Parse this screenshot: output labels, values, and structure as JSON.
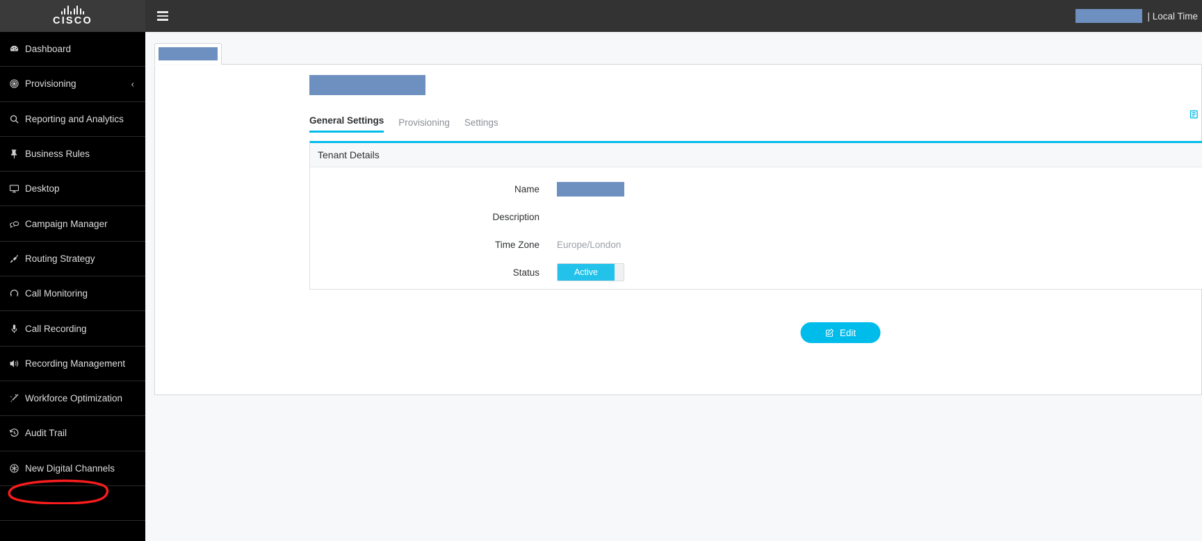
{
  "topbar": {
    "logo_text": "CISCO",
    "menu_icon": "hamburger-icon",
    "user_redacted": "",
    "local_time_label": "| Local Time"
  },
  "sidebar": {
    "items": [
      {
        "label": "Dashboard",
        "icon": "dashboard-icon",
        "expandable": false
      },
      {
        "label": "Provisioning",
        "icon": "target-icon",
        "expandable": true,
        "chevron": "‹"
      },
      {
        "label": "Reporting and Analytics",
        "icon": "search-icon",
        "expandable": false
      },
      {
        "label": "Business Rules",
        "icon": "pin-icon",
        "expandable": false
      },
      {
        "label": "Desktop",
        "icon": "monitor-icon",
        "expandable": false
      },
      {
        "label": "Campaign Manager",
        "icon": "chat-bubbles-icon",
        "expandable": false
      },
      {
        "label": "Routing Strategy",
        "icon": "plug-icon",
        "expandable": false
      },
      {
        "label": "Call Monitoring",
        "icon": "headset-icon",
        "expandable": false
      },
      {
        "label": "Call Recording",
        "icon": "microphone-icon",
        "expandable": false
      },
      {
        "label": "Recording Management",
        "icon": "speaker-icon",
        "expandable": false
      },
      {
        "label": "Workforce Optimization",
        "icon": "magic-wand-icon",
        "expandable": false
      },
      {
        "label": "Audit Trail",
        "icon": "history-icon",
        "expandable": false
      },
      {
        "label": "New Digital Channels",
        "icon": "asterisk-circle-icon",
        "expandable": false,
        "annotated": true
      }
    ],
    "annotation_color": "#f91c1c"
  },
  "main": {
    "tab_redacted": "",
    "page_title_redacted": "",
    "share_icon": "external-link-icon",
    "subtabs": [
      {
        "label": "General Settings",
        "active": true
      },
      {
        "label": "Provisioning",
        "active": false
      },
      {
        "label": "Settings",
        "active": false
      }
    ],
    "panel": {
      "heading": "Tenant Details",
      "fields": [
        {
          "label": "Name",
          "value": "",
          "type": "redacted"
        },
        {
          "label": "Description",
          "value": "",
          "type": "text"
        },
        {
          "label": "Time Zone",
          "value": "Europe/London",
          "type": "text"
        },
        {
          "label": "Status",
          "value": "Active",
          "type": "toggle"
        }
      ]
    },
    "edit_button": {
      "label": "Edit",
      "icon": "pencil-square-icon"
    }
  },
  "colors": {
    "accent_cyan": "#00bceb",
    "toggle_cyan": "#22c2ea",
    "redaction_blue": "#6d90c0",
    "sidebar_black": "#000000",
    "topbar_grey": "#333333",
    "annotation_red": "#f91c1c"
  }
}
